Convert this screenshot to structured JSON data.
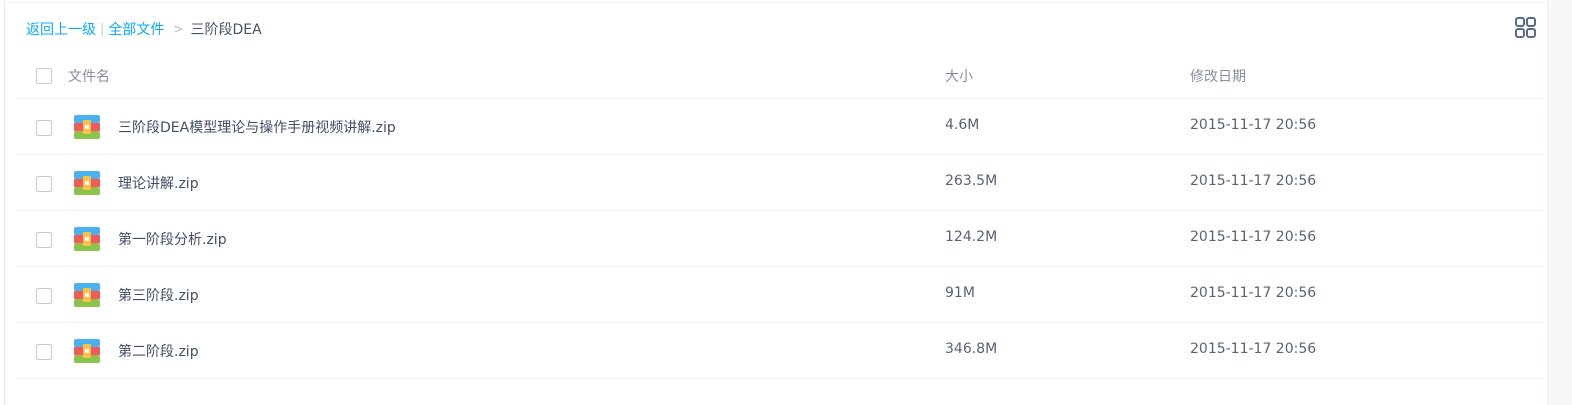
{
  "breadcrumb": {
    "back": "返回上一级",
    "separator": "|",
    "all_files": "全部文件",
    "arrow": ">",
    "current": "三阶段DEA"
  },
  "toolbar": {
    "view_toggle_icon": "grid-view-icon"
  },
  "table": {
    "columns": {
      "name": "文件名",
      "size": "大小",
      "modified": "修改日期"
    },
    "rows": [
      {
        "name": "三阶段DEA模型理论与操作手册视频讲解.zip",
        "size": "4.6M",
        "modified": "2015-11-17 20:56",
        "icon": "zip-archive-icon"
      },
      {
        "name": "理论讲解.zip",
        "size": "263.5M",
        "modified": "2015-11-17 20:56",
        "icon": "zip-archive-icon"
      },
      {
        "name": "第一阶段分析.zip",
        "size": "124.2M",
        "modified": "2015-11-17 20:56",
        "icon": "zip-archive-icon"
      },
      {
        "name": "第三阶段.zip",
        "size": "91M",
        "modified": "2015-11-17 20:56",
        "icon": "zip-archive-icon"
      },
      {
        "name": "第二阶段.zip",
        "size": "346.8M",
        "modified": "2015-11-17 20:56",
        "icon": "zip-archive-icon"
      }
    ]
  },
  "colors": {
    "link": "#09aaff",
    "text": "#424e67",
    "muted": "#888f9e",
    "divider": "#eef0f3"
  }
}
